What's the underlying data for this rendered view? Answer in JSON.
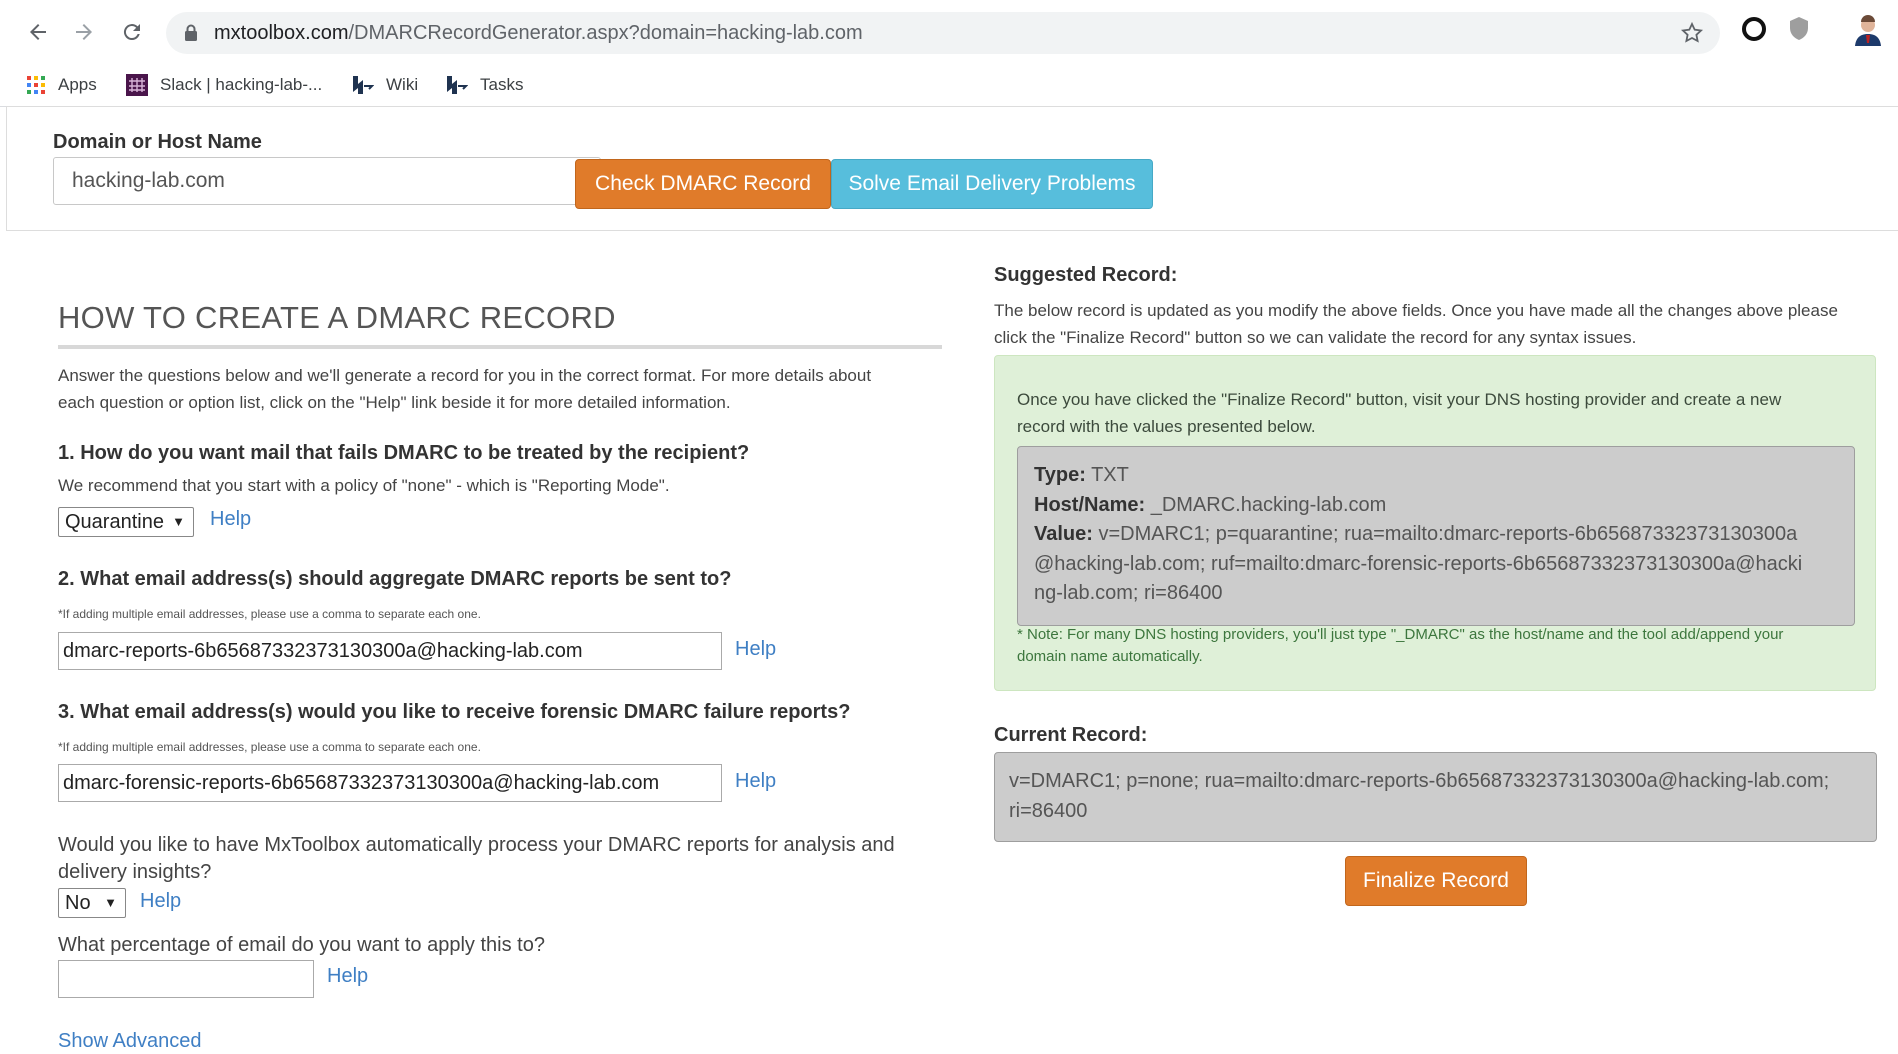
{
  "browser": {
    "url_host": "mxtoolbox.com",
    "url_path": "/DMARCRecordGenerator.aspx?domain=hacking-lab.com",
    "bookmarks": [
      {
        "label": "Apps",
        "icon": "apps-grid-icon"
      },
      {
        "label": "Slack | hacking-lab-...",
        "icon": "slack-icon"
      },
      {
        "label": "Wiki",
        "icon": "hackinglab-icon"
      },
      {
        "label": "Tasks",
        "icon": "hackinglab-icon"
      }
    ]
  },
  "domain_form": {
    "label": "Domain or Host Name",
    "value": "hacking-lab.com",
    "check_button": "Check DMARC Record",
    "solve_button": "Solve Email Delivery Problems"
  },
  "howto": {
    "title": "HOW TO CREATE A DMARC RECORD",
    "intro_line1": "Answer the questions below and we'll generate a record for you in the correct format. For more details about",
    "intro_line2": "each question or option list, click on the \"Help\" link beside it for more detailed information.",
    "q1": {
      "heading": "1. How do you want mail that fails DMARC to be treated by the recipient?",
      "hint": "We recommend that you start with a policy of \"none\" - which is \"Reporting Mode\".",
      "selected": "Quarantine",
      "help": "Help"
    },
    "q2": {
      "heading": "2. What email address(s) should aggregate DMARC reports be sent to?",
      "note": "*If adding multiple email addresses, please use a comma to separate each one.",
      "value": "dmarc-reports-6b65687332373130300a@hacking-lab.com",
      "help": "Help"
    },
    "q3": {
      "heading": "3. What email address(s) would you like to receive forensic DMARC failure reports?",
      "note": "*If adding multiple email addresses, please use a comma to separate each one.",
      "value": "dmarc-forensic-reports-6b65687332373130300a@hacking-lab.com",
      "help": "Help"
    },
    "q4": {
      "line1": "Would you like to have MxToolbox automatically process your DMARC reports for analysis and",
      "line2": "delivery insights?",
      "selected": "No",
      "help": "Help"
    },
    "q5": {
      "question": "What percentage of email do you want to apply this to?",
      "value": "",
      "help": "Help"
    },
    "show_advanced": "Show Advanced"
  },
  "suggested": {
    "label": "Suggested Record:",
    "desc_line1": "The below record is updated as you modify the above fields. Once you have made all the changes above please",
    "desc_line2": "click the \"Finalize Record\" button so we can validate the record for any syntax issues.",
    "intro_line1": "Once you have clicked the \"Finalize Record\" button, visit your DNS hosting provider and create a new",
    "intro_line2": "record with the values presented below.",
    "type_label": "Type:",
    "type_value": "TXT",
    "host_label": "Host/Name:",
    "host_value": "_DMARC.hacking-lab.com",
    "value_label": "Value:",
    "value_line1": "v=DMARC1; p=quarantine; rua=mailto:dmarc-reports-6b65687332373130300a",
    "value_line2": "@hacking-lab.com; ruf=mailto:dmarc-forensic-reports-6b65687332373130300a@hacki",
    "value_line3": "ng-lab.com; ri=86400",
    "note_line1": "* Note: For many DNS hosting providers, you'll just type \"_DMARC\" as the host/name and the tool add/append your",
    "note_line2": "domain name automatically."
  },
  "current": {
    "label": "Current Record:",
    "line1": "v=DMARC1; p=none; rua=mailto:dmarc-reports-6b65687332373130300a@hacking-lab.com;",
    "line2": "ri=86400"
  },
  "finalize_button": "Finalize Record",
  "colors": {
    "check_button": "#e07b2a",
    "solve_button": "#57bedc",
    "link": "#3f7fc4",
    "green_panel": "#dff0d8",
    "record_box": "#cccccc"
  }
}
